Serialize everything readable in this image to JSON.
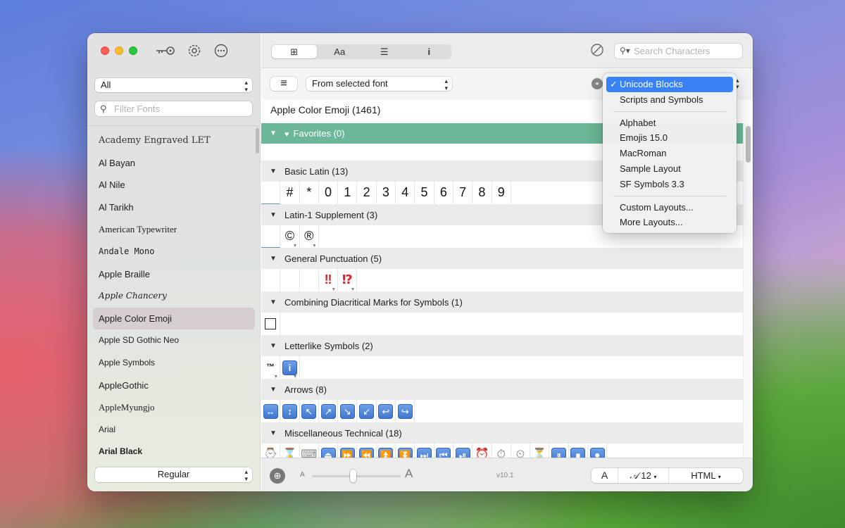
{
  "sidebar": {
    "collection_filter": "All",
    "filter_placeholder": "Filter Fonts",
    "fonts": [
      "Academy Engraved LET",
      "Al Bayan",
      "Al Nile",
      "Al Tarikh",
      "American Typewriter",
      "Andale Mono",
      "Apple Braille",
      "Apple Chancery",
      "Apple Color Emoji",
      "Apple SD Gothic Neo",
      "Apple Symbols",
      "AppleGothic",
      "AppleMyungjo",
      "Arial",
      "Arial Black"
    ],
    "selected_font": "Apple Color Emoji",
    "style": "Regular"
  },
  "toolbar": {
    "seg_grid": "⊞",
    "seg_text": "Aa",
    "seg_list": "☰",
    "seg_info": "i",
    "search_placeholder": "Search Characters"
  },
  "subbar": {
    "list_icon": "≡",
    "source": "From selected font"
  },
  "font_title": "Apple Color Emoji (1461)",
  "sections": {
    "favorites": "Favorites (0)",
    "basic_latin": "Basic Latin (13)",
    "latin1": "Latin-1 Supplement (3)",
    "general_punct": "General Punctuation (5)",
    "combining": "Combining Diacritical Marks for Symbols (1)",
    "letterlike": "Letterlike Symbols (2)",
    "arrows": "Arrows (8)",
    "misc_tech": "Miscellaneous Technical (18)"
  },
  "glyphs": {
    "basic_latin": [
      "#",
      "*",
      "0",
      "1",
      "2",
      "3",
      "4",
      "5",
      "6",
      "7",
      "8",
      "9"
    ],
    "latin1": [
      "©",
      "®"
    ],
    "general_punct": [
      "‼",
      "⁉"
    ],
    "combining": [
      "⃣"
    ],
    "letterlike": [
      "™",
      "i"
    ],
    "arrows": [
      "↔",
      "↕",
      "↖",
      "↗",
      "↘",
      "↙",
      "↩",
      "↪"
    ],
    "misc_tech": [
      "⌚",
      "⌛",
      "⌨",
      "⏏",
      "⏩",
      "⏪",
      "⏫",
      "⏬",
      "⏭",
      "⏮",
      "⏯",
      "⏰",
      "⏱",
      "⏲",
      "⏳",
      "⏸",
      "⏹",
      "⏺"
    ]
  },
  "bottom": {
    "small_a": "A",
    "big_a": "A",
    "version": "v10.1",
    "glyph_btn": "A",
    "size": "12",
    "export": "HTML"
  },
  "menu": {
    "items": [
      "Unicode Blocks",
      "Scripts and Symbols",
      "Alphabet",
      "Emojis 15.0",
      "MacRoman",
      "Sample Layout",
      "SF Symbols 3.3",
      "Custom Layouts...",
      "More Layouts..."
    ],
    "selected": "Unicode Blocks",
    "check": "✓"
  },
  "colors": {
    "favorites_bar": "#6cb797",
    "menu_highlight": "#3a82f7",
    "emoji_red": "#d8232a",
    "emoji_blue": "#3f74cf"
  }
}
